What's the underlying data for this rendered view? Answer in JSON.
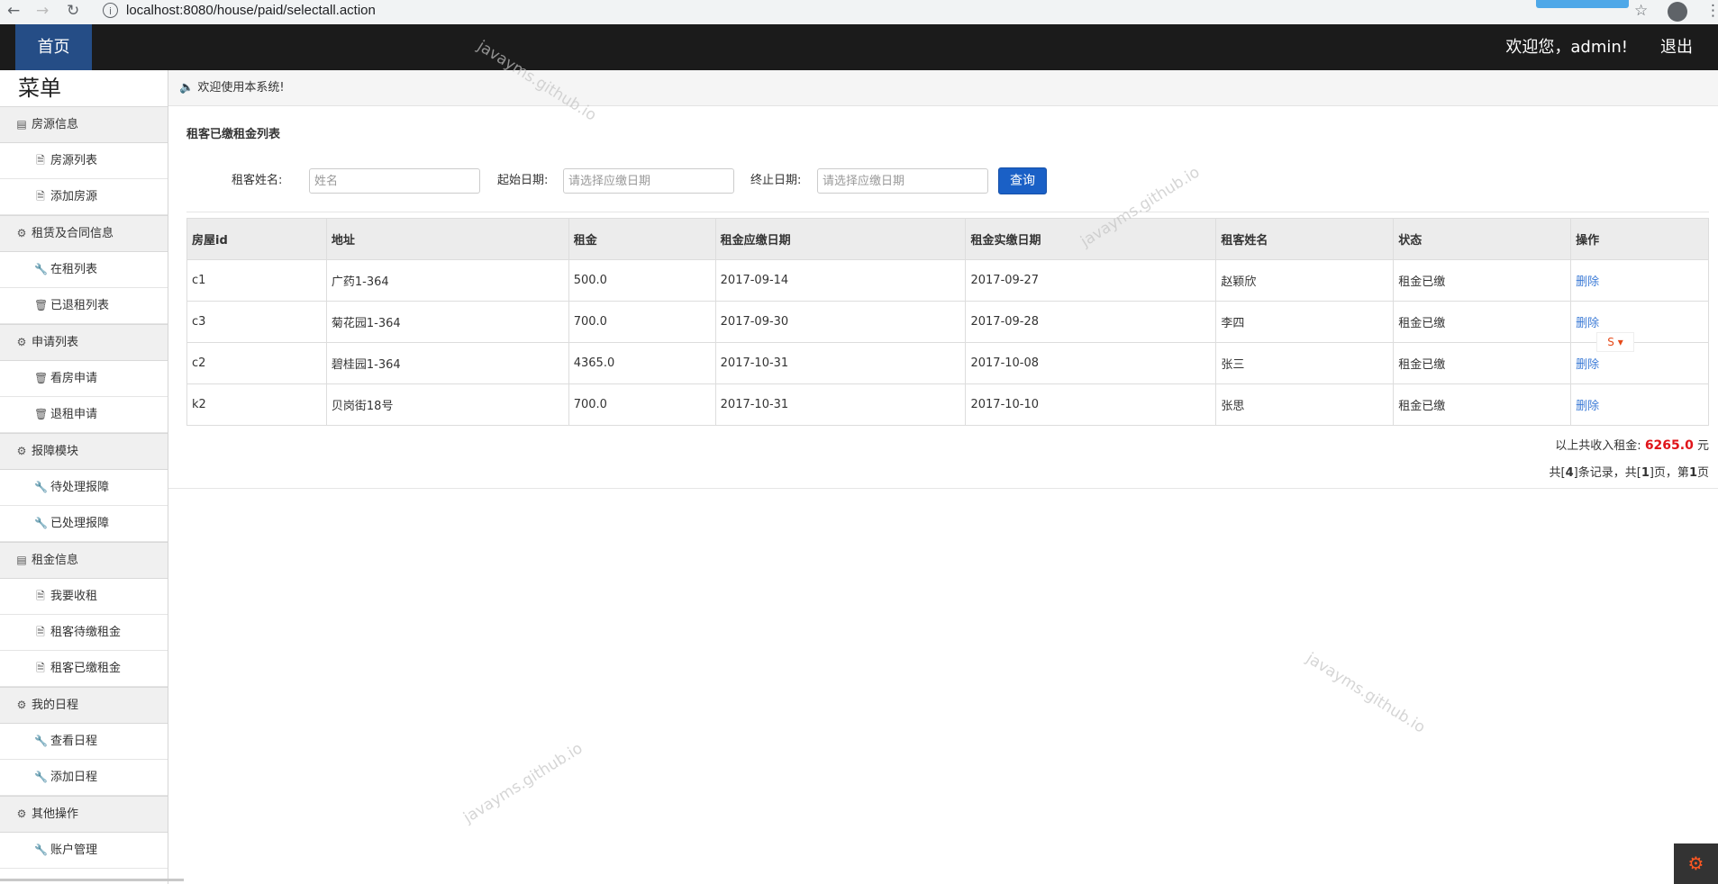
{
  "browser": {
    "url": "localhost:8080/house/paid/selectall.action"
  },
  "navbar": {
    "home": "首页",
    "welcome": "欢迎您，admin!",
    "logout": "退出"
  },
  "sidebar": {
    "title": "菜单",
    "groups": [
      {
        "label": "房源信息",
        "icon": "card-icon",
        "items": [
          {
            "label": "房源列表",
            "icon": "file-icon"
          },
          {
            "label": "添加房源",
            "icon": "file-icon"
          }
        ]
      },
      {
        "label": "租赁及合同信息",
        "icon": "gear-icon",
        "items": [
          {
            "label": "在租列表",
            "icon": "wrench-icon"
          },
          {
            "label": "已退租列表",
            "icon": "trash-icon"
          }
        ]
      },
      {
        "label": "申请列表",
        "icon": "gear-icon",
        "items": [
          {
            "label": "看房申请",
            "icon": "trash-icon"
          },
          {
            "label": "退租申请",
            "icon": "trash-icon"
          }
        ]
      },
      {
        "label": "报障模块",
        "icon": "gear-icon",
        "items": [
          {
            "label": "待处理报障",
            "icon": "wrench-icon"
          },
          {
            "label": "已处理报障",
            "icon": "wrench-icon"
          }
        ]
      },
      {
        "label": "租金信息",
        "icon": "card-icon",
        "items": [
          {
            "label": "我要收租",
            "icon": "file-icon"
          },
          {
            "label": "租客待缴租金",
            "icon": "file-icon"
          },
          {
            "label": "租客已缴租金",
            "icon": "file-icon"
          }
        ]
      },
      {
        "label": "我的日程",
        "icon": "gear-icon",
        "items": [
          {
            "label": "查看日程",
            "icon": "wrench-icon"
          },
          {
            "label": "添加日程",
            "icon": "wrench-icon"
          }
        ]
      },
      {
        "label": "其他操作",
        "icon": "gear-icon",
        "items": [
          {
            "label": "账户管理",
            "icon": "wrench-icon"
          }
        ]
      }
    ]
  },
  "notice": "欢迎使用本系统!",
  "page": {
    "title": "租客已缴租金列表"
  },
  "search": {
    "name_label": "租客姓名:",
    "name_placeholder": "姓名",
    "start_label": "起始日期:",
    "start_placeholder": "请选择应缴日期",
    "end_label": "终止日期:",
    "end_placeholder": "请选择应缴日期",
    "query": "查询"
  },
  "table": {
    "headers": [
      "房屋id",
      "地址",
      "租金",
      "租金应缴日期",
      "租金实缴日期",
      "租客姓名",
      "状态",
      "操作"
    ],
    "rows": [
      [
        "c1",
        "广药1-364",
        "500.0",
        "2017-09-14",
        "2017-09-27",
        "赵颖欣",
        "租金已缴",
        "删除"
      ],
      [
        "c3",
        "菊花园1-364",
        "700.0",
        "2017-09-30",
        "2017-09-28",
        "李四",
        "租金已缴",
        "删除"
      ],
      [
        "c2",
        "碧桂园1-364",
        "4365.0",
        "2017-10-31",
        "2017-10-08",
        "张三",
        "租金已缴",
        "删除"
      ],
      [
        "k2",
        "贝岗街18号",
        "700.0",
        "2017-10-31",
        "2017-10-10",
        "张思",
        "租金已缴",
        "删除"
      ]
    ]
  },
  "summary": {
    "prefix": "以上共收入租金:",
    "amount": "6265.0",
    "unit": "元"
  },
  "pager": {
    "p1": "共[",
    "records": "4",
    "p2": "]条记录，共[",
    "pages": "1",
    "p3": "]页，第",
    "current": "1",
    "p4": "页"
  },
  "watermark": "javayms.github.io",
  "colors": {
    "navbar": "#1b1b1b",
    "home_active": "#254d86",
    "accent_button": "#1a60c6",
    "amount": "#e0141a",
    "link": "#3c7bd6"
  }
}
